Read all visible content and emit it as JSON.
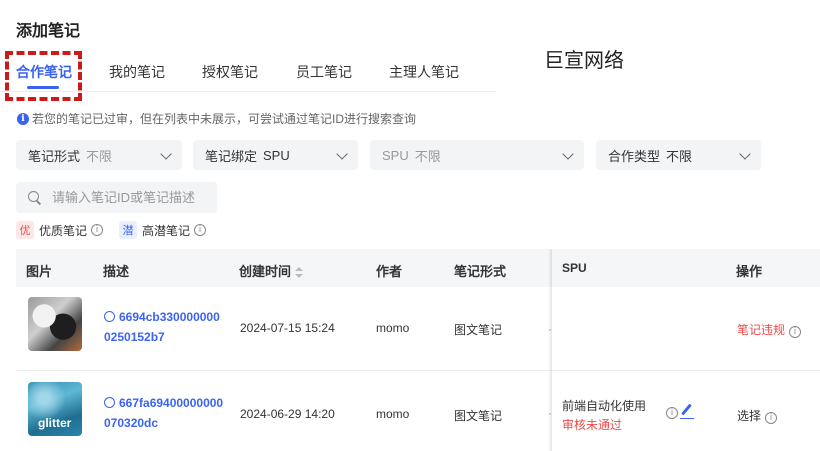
{
  "page_title": "添加笔记",
  "brand": "巨宣网络",
  "tabs": [
    {
      "label": "合作笔记",
      "active": true
    },
    {
      "label": "我的笔记",
      "active": false
    },
    {
      "label": "授权笔记",
      "active": false
    },
    {
      "label": "员工笔记",
      "active": false
    },
    {
      "label": "主理人笔记",
      "active": false
    }
  ],
  "notice": "若您的笔记已过审，但在列表中未展示，可尝试通过笔记ID进行搜索查询",
  "filters": [
    {
      "label": "笔记形式",
      "value": "不限"
    },
    {
      "label": "笔记绑定",
      "value": "SPU"
    },
    {
      "label": "SPU",
      "value": "不限"
    },
    {
      "label": "合作类型",
      "value": "不限"
    }
  ],
  "search": {
    "placeholder": "请输入笔记ID或笔记描述"
  },
  "tags": [
    {
      "badge": "优",
      "label": "优质笔记"
    },
    {
      "badge": "潜",
      "label": "高潜笔记"
    }
  ],
  "table": {
    "headers": {
      "image": "图片",
      "desc": "描述",
      "created": "创建时间",
      "author": "作者",
      "form": "笔记形式",
      "spu": "SPU",
      "action": "操作"
    },
    "rows": [
      {
        "id_line1": "6694cb330000000",
        "id_line2": "0250152b7",
        "created": "2024-07-15 15:24",
        "author": "momo",
        "form": "图文笔记",
        "spu_name": "",
        "spu_status": "",
        "action": "笔记违规"
      },
      {
        "thumb_text": "glitter",
        "id_line1": "667fa69400000000",
        "id_line2": "070320dc",
        "created": "2024-06-29 14:20",
        "author": "momo",
        "form": "图文笔记",
        "spu_name": "前端自动化使用",
        "spu_status": "审核未通过",
        "action": "选择"
      }
    ]
  },
  "colors": {
    "accent": "#3a63f2",
    "danger": "#f04848"
  }
}
